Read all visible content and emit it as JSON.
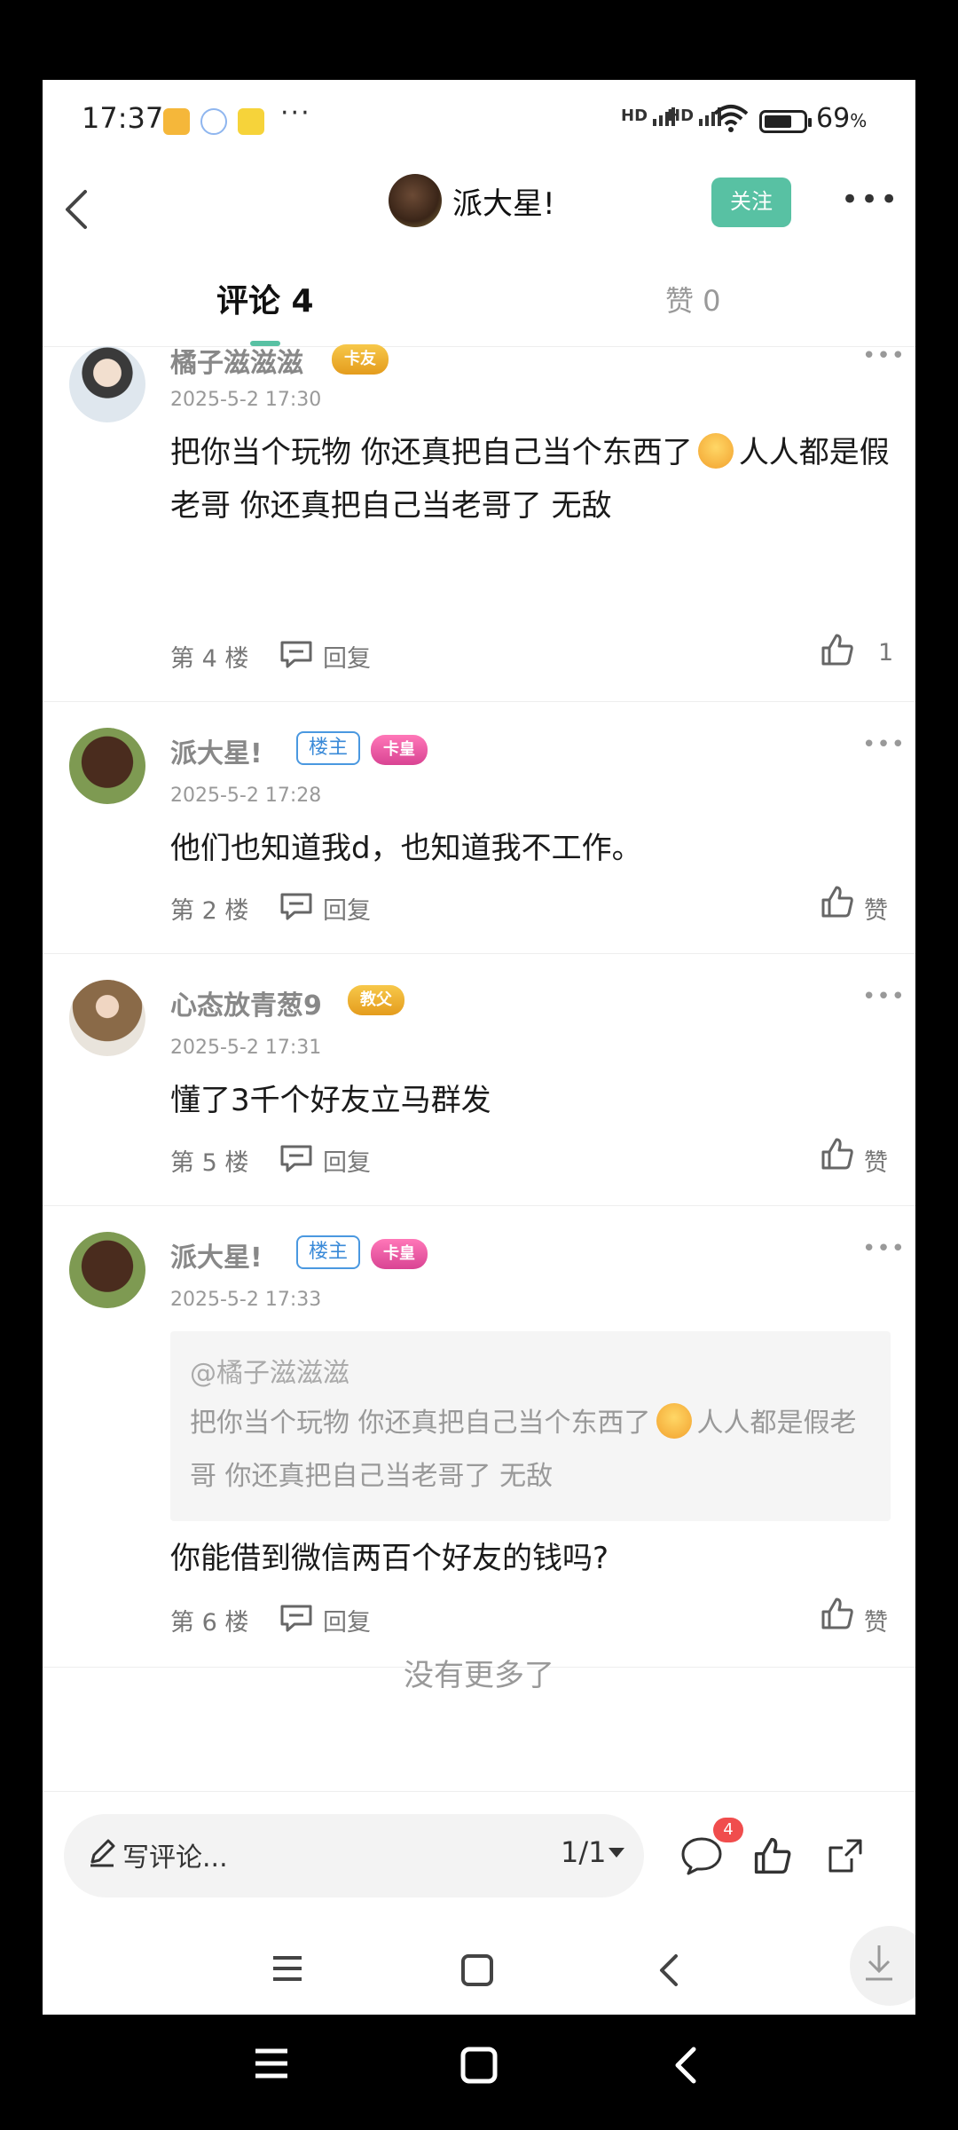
{
  "status_bar": {
    "time": "17:37",
    "signal_1": "HD",
    "signal_2": "HD",
    "battery": "69",
    "battery_unit": "%"
  },
  "header": {
    "username": "派大星!",
    "follow_label": "关注"
  },
  "tabs": {
    "comments": "评论 4",
    "likes": "赞 0"
  },
  "comments": [
    {
      "username": "橘子滋滋滋",
      "crown": "卡友",
      "host_badge": "",
      "date": "2025-5-2 17:30",
      "text_1": "把你当个玩物 你还真把自己当个东西了",
      "text_2": "人人都是假老哥 你还真把自己当老哥了 无敌",
      "floor": "第 4 楼",
      "reply": "回复",
      "likes": "1"
    },
    {
      "username": "派大星!",
      "crown": "卡皇",
      "host_badge": "楼主",
      "date": "2025-5-2 17:28",
      "text_1": "他们也知道我d，也知道我不工作。",
      "floor": "第 2 楼",
      "reply": "回复",
      "likes": "赞"
    },
    {
      "username": "心态放青葱9",
      "crown": "教父",
      "host_badge": "",
      "date": "2025-5-2 17:31",
      "text_1": "懂了3千个好友立马群发",
      "floor": "第 5 楼",
      "reply": "回复",
      "likes": "赞"
    },
    {
      "username": "派大星!",
      "crown": "卡皇",
      "host_badge": "楼主",
      "date": "2025-5-2 17:33",
      "quote_at": "@橘子滋滋滋",
      "quote_1": "把你当个玩物 你还真把自己当个东西了",
      "quote_2": "人人都是假老哥 你还真把自己当老哥了 无敌",
      "text_1": "你能借到微信两百个好友的钱吗?",
      "floor": "第 6 楼",
      "reply": "回复",
      "likes": "赞"
    }
  ],
  "no_more": "没有更多了",
  "bottom_bar": {
    "placeholder": "写评论...",
    "page": "1/1",
    "comment_count": "4"
  },
  "colors": {
    "accent": "#58c1a3",
    "badge_red": "#f04d4d",
    "host_blue": "#3a8ad8"
  },
  "icons": [
    "back-icon",
    "more-icon",
    "reply-icon",
    "like-icon",
    "pen-icon",
    "comment-icon",
    "share-icon",
    "menu-icon",
    "home-icon",
    "nav-back-icon",
    "download-icon"
  ]
}
